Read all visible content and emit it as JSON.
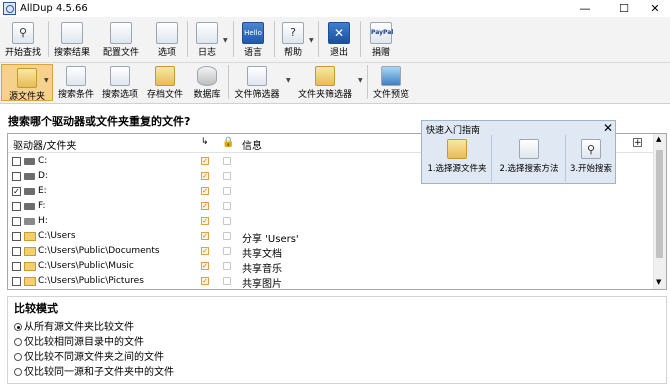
{
  "window": {
    "title": "AllDup 4.5.66",
    "min": "—",
    "max": "☐",
    "close": "✕"
  },
  "toolbar_main": [
    {
      "name": "start-search",
      "label": "开始查找",
      "icon": "magnifier-icon"
    },
    {
      "name": "search-results",
      "label": "搜索结果",
      "icon": "results-list-icon"
    },
    {
      "name": "config-file",
      "label": "配置文件",
      "icon": "config-file-icon"
    },
    {
      "name": "options",
      "label": "选项",
      "icon": "options-icon"
    },
    {
      "name": "log",
      "label": "日志",
      "icon": "log-icon"
    },
    {
      "name": "language",
      "label": "语言",
      "icon": "hello-language-icon",
      "icon_text": "Hello"
    },
    {
      "name": "help",
      "label": "帮助",
      "icon": "help-icon",
      "icon_text": "?"
    },
    {
      "name": "exit",
      "label": "退出",
      "icon": "exit-icon",
      "icon_text": "✕"
    },
    {
      "name": "donate",
      "label": "捐赠",
      "icon": "paypal-icon",
      "icon_text": "PayPal"
    }
  ],
  "toolbar_source": [
    {
      "name": "source-folders",
      "label": "源文件夹",
      "active": true
    },
    {
      "name": "search-criteria",
      "label": "搜索条件"
    },
    {
      "name": "search-options",
      "label": "搜索选项"
    },
    {
      "name": "store-files",
      "label": "存档文件"
    },
    {
      "name": "database",
      "label": "数据库"
    },
    {
      "name": "file-filter",
      "label": "文件筛选器"
    },
    {
      "name": "folder-filter",
      "label": "文件夹筛选器"
    },
    {
      "name": "file-preview",
      "label": "文件预览"
    }
  ],
  "question": "搜索哪个驱动器或文件夹重复的文件?",
  "grid": {
    "col_drive": "驱动器/文件夹",
    "col_subfolder_icon": "subfolder-icon",
    "col_lock_icon": "lock-icon",
    "col_info": "信息",
    "rows": [
      {
        "type": "drive",
        "path": "C:",
        "checked": false,
        "info": ""
      },
      {
        "type": "drive",
        "path": "D:",
        "checked": false,
        "info": ""
      },
      {
        "type": "drive",
        "path": "E:",
        "checked": true,
        "info": ""
      },
      {
        "type": "drive",
        "path": "F:",
        "checked": false,
        "info": ""
      },
      {
        "type": "drive",
        "path": "H:",
        "checked": false,
        "info": ""
      },
      {
        "type": "folder",
        "path": "C:\\Users",
        "checked": false,
        "info": "分享 'Users'"
      },
      {
        "type": "folder",
        "path": "C:\\Users\\Public\\Documents",
        "checked": false,
        "info": "共享文档"
      },
      {
        "type": "folder",
        "path": "C:\\Users\\Public\\Music",
        "checked": false,
        "info": "共享音乐"
      },
      {
        "type": "folder",
        "path": "C:\\Users\\Public\\Pictures",
        "checked": false,
        "info": "共享图片"
      }
    ]
  },
  "quickstart": {
    "title": "快速入门指南",
    "steps": [
      {
        "label": "1.选择源文件夹"
      },
      {
        "label": "2.选择搜索方法"
      },
      {
        "label": "3.开始搜索"
      }
    ]
  },
  "compare": {
    "title": "比较模式",
    "options": [
      {
        "label": "从所有源文件夹比较文件",
        "selected": true
      },
      {
        "label": "仅比较相同源目录中的文件",
        "selected": false
      },
      {
        "label": "仅比较不同源文件夹之间的文件",
        "selected": false
      },
      {
        "label": "仅比较同一源和子文件夹中的文件",
        "selected": false
      }
    ]
  }
}
